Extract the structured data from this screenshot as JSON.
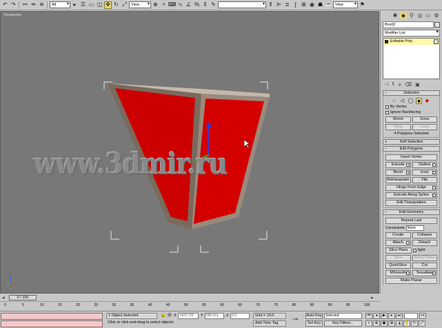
{
  "toolbar": {
    "selection_filter": "All",
    "ref_coord": "View",
    "ref_coord2": "View"
  },
  "viewport": {
    "label": "Perspective",
    "watermark": "www.3dmir.ru"
  },
  "command_panel": {
    "object_name": "Box02",
    "modifier_list": "Modifier List",
    "stack_item": "Editable Poly"
  },
  "selection_rollout": {
    "title": "Selection",
    "by_vertex": "By Vertex",
    "ignore_backfacing": "Ignore Backfacing",
    "shrink": "Shrink",
    "grow": "Grow",
    "ring": "Ring",
    "loop": "Loop",
    "status": "4 Polygons Selected"
  },
  "soft_selection": {
    "title": "Soft Selection"
  },
  "edit_polygons": {
    "title": "Edit Polygons",
    "insert_vertex": "Insert Vertex",
    "extrude": "Extrude",
    "outline": "Outline",
    "bevel": "Bevel",
    "inset": "Inset",
    "retriangulate": "Retriangulate",
    "flip": "Flip",
    "hinge_from_edge": "Hinge From Edge",
    "extrude_along_spline": "Extrude Along Spline",
    "edit_triangulation": "Edit Triangulation"
  },
  "edit_geometry": {
    "title": "Edit Geometry",
    "repeat_last": "Repeat Last",
    "constraints_label": "Constraints",
    "constraints_value": "None",
    "create": "Create",
    "collapse": "Collapse",
    "attach": "Attach",
    "detach": "Detach",
    "slice_plane": "Slice Plane",
    "split": "Split",
    "slice": "Slice",
    "reset_plane": "Reset Plane",
    "quickslice": "QuickSlice",
    "cut": "Cut",
    "msmooth": "MSmooth",
    "tessellate": "Tessellate",
    "make_planar": "Make Planar"
  },
  "timeline": {
    "frame": "0 / 100",
    "ticks": [
      "0",
      "5",
      "10",
      "15",
      "20",
      "25",
      "30",
      "35",
      "40",
      "45",
      "50",
      "55",
      "60",
      "65",
      "70",
      "75",
      "80",
      "85",
      "90",
      "95",
      "100"
    ]
  },
  "status": {
    "selected": "1 Object Selected",
    "prompt": "Click or click-and-drag to select objects",
    "x_label": "X",
    "x_value": "1422.716",
    "y_label": "Y",
    "y_value": "680.911",
    "z_label": "Z",
    "z_value": "0.0",
    "grid": "Grid = 10.0",
    "add_time_tag": "Add Time Tag",
    "auto_key": "Auto Key",
    "auto_key_mode": "Selected",
    "set_key": "Set Key",
    "key_filters": "Key Filters..."
  },
  "colors": {
    "viewport_bg": "#787878",
    "polygon_red": "#d40000",
    "stack_highlight": "#fff9a8",
    "status_pink": "#f4c8c8"
  }
}
